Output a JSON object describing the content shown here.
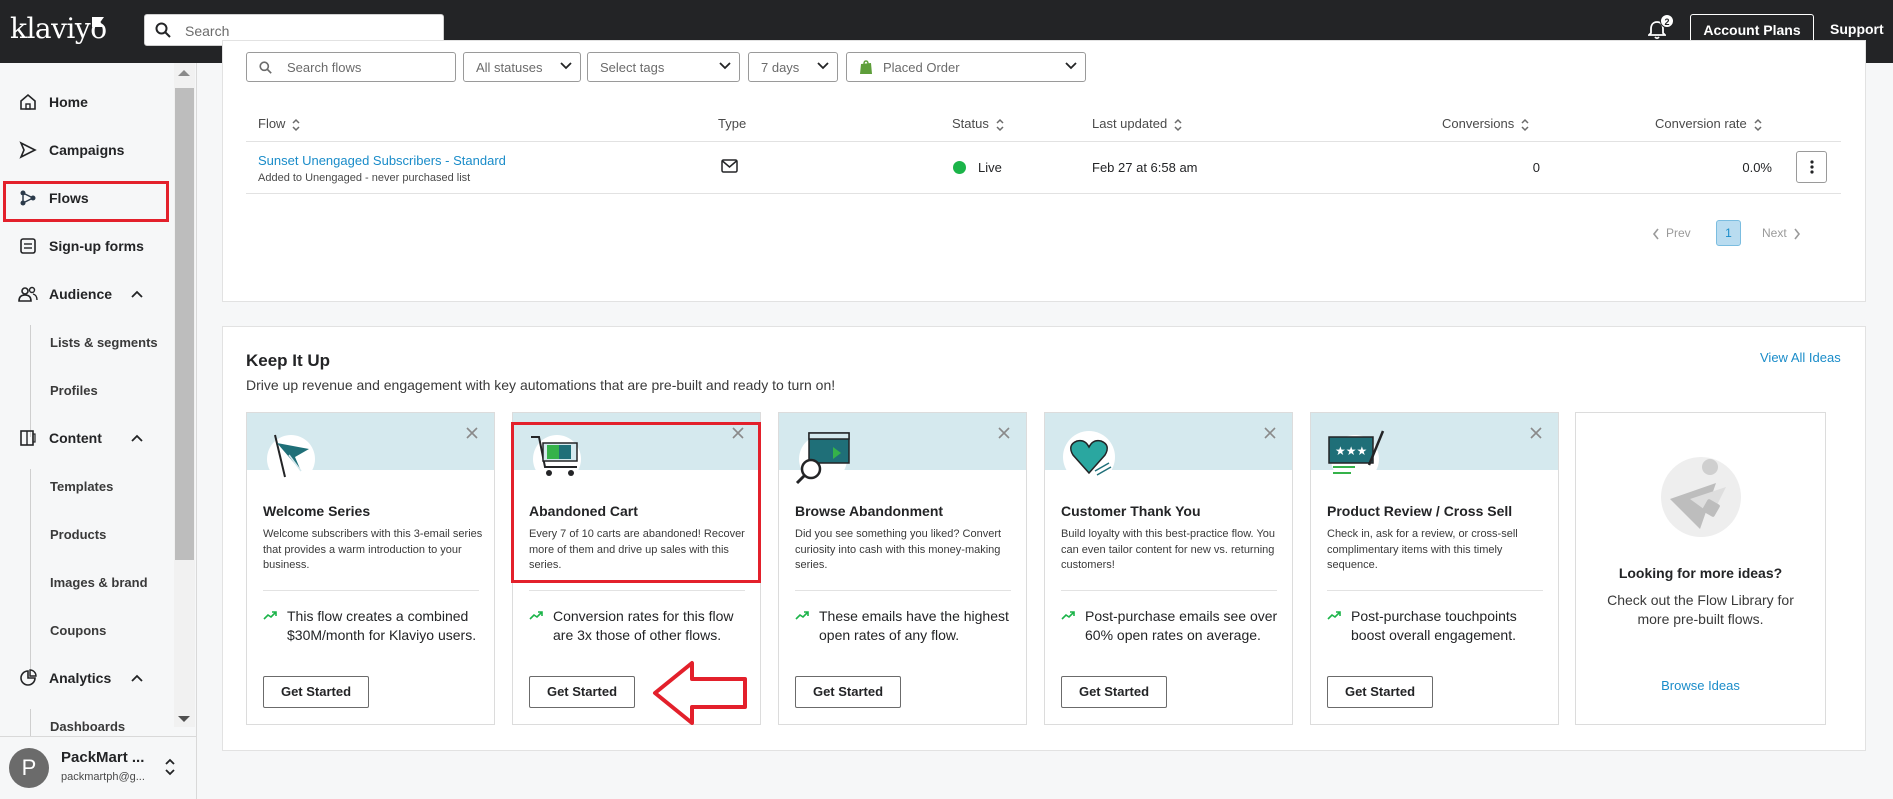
{
  "topbar": {
    "logo": "klaviyo",
    "search_placeholder": "Search",
    "notifications_count": "2",
    "account_plans_label": "Account Plans",
    "support_label": "Support"
  },
  "sidebar": {
    "items": [
      {
        "label": "Home",
        "icon": "home-icon"
      },
      {
        "label": "Campaigns",
        "icon": "send-icon"
      },
      {
        "label": "Flows",
        "icon": "flows-icon"
      },
      {
        "label": "Sign-up forms",
        "icon": "form-icon"
      },
      {
        "label": "Audience",
        "icon": "people-icon"
      },
      {
        "label": "Content",
        "icon": "content-icon"
      },
      {
        "label": "Analytics",
        "icon": "analytics-icon"
      }
    ],
    "audience_sub": [
      "Lists & segments",
      "Profiles"
    ],
    "content_sub": [
      "Templates",
      "Products",
      "Images & brand",
      "Coupons"
    ],
    "analytics_sub": [
      "Dashboards"
    ],
    "account": {
      "initial": "P",
      "name": "PackMart ...",
      "email": "packmartph@g..."
    }
  },
  "filters": {
    "search_placeholder": "Search flows",
    "status": "All statuses",
    "tags": "Select tags",
    "period": "7 days",
    "metric": "Placed Order"
  },
  "table": {
    "headers": {
      "flow": "Flow",
      "type": "Type",
      "status": "Status",
      "last_updated": "Last updated",
      "conversions": "Conversions",
      "conversion_rate": "Conversion rate"
    },
    "rows": [
      {
        "name": "Sunset Unengaged Subscribers - Standard",
        "sub": "Added to Unengaged - never purchased list",
        "type": "email",
        "status": "Live",
        "last_updated": "Feb 27 at 6:58 am",
        "conversions": "0",
        "conversion_rate": "0.0%"
      }
    ]
  },
  "pagination": {
    "prev": "Prev",
    "page": "1",
    "next": "Next"
  },
  "keep_it_up": {
    "title": "Keep It Up",
    "subtitle": "Drive up revenue and engagement with key automations that are pre-built and ready to turn on!",
    "view_all": "View All Ideas",
    "tiles": [
      {
        "name": "Welcome Series",
        "desc": "Welcome subscribers with this 3-email series that provides a warm introduction to your business.",
        "stat": "This flow creates a combined $30M/month for Klaviyo users.",
        "button": "Get Started"
      },
      {
        "name": "Abandoned Cart",
        "desc": "Every 7 of 10 carts are abandoned! Recover more of them and drive up sales with this series.",
        "stat": "Conversion rates for this flow are 3x those of other flows.",
        "button": "Get Started"
      },
      {
        "name": "Browse Abandonment",
        "desc": "Did you see something you liked? Convert curiosity into cash with this money-making series.",
        "stat": "These emails have the highest open rates of any flow.",
        "button": "Get Started"
      },
      {
        "name": "Customer Thank You",
        "desc": "Build loyalty with this best-practice flow. You can even tailor content for new vs. returning customers!",
        "stat": "Post-purchase emails see over 60% open rates on average.",
        "button": "Get Started"
      },
      {
        "name": "Product Review / Cross Sell",
        "desc": "Check in, ask for a review, or cross-sell complimentary items with this timely sequence.",
        "stat": "Post-purchase touchpoints boost overall engagement.",
        "button": "Get Started"
      }
    ],
    "more": {
      "title": "Looking for more ideas?",
      "desc": "Check out the Flow Library for more pre-built flows.",
      "link": "Browse Ideas"
    }
  },
  "colors": {
    "accent_link": "#1a8cc9",
    "live": "#1bb449",
    "highlight": "#e3202b",
    "topbar": "#232426"
  }
}
